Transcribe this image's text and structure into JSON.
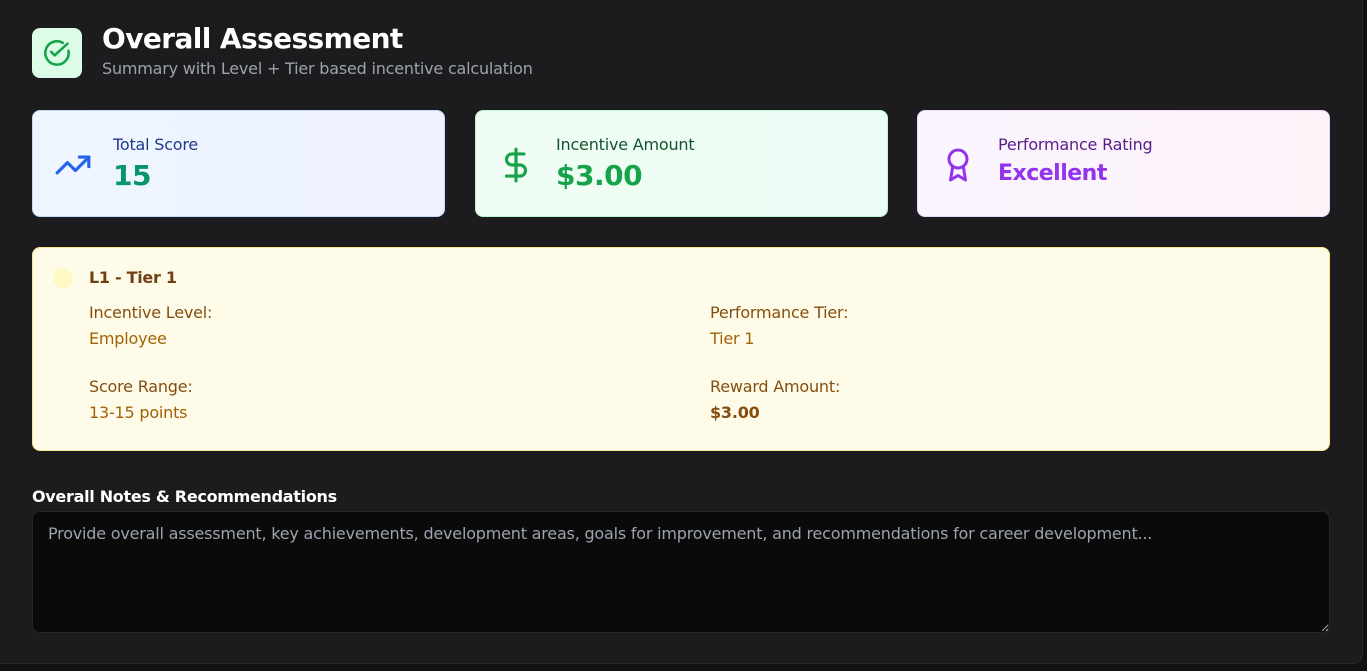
{
  "header": {
    "title": "Overall Assessment",
    "subtitle": "Summary with Level + Tier based incentive calculation",
    "icon": "check-circle-icon",
    "icon_color": "#16a34a"
  },
  "stats": {
    "score": {
      "label": "Total Score",
      "value": "15",
      "icon": "trending-up-icon"
    },
    "incentive": {
      "label": "Incentive Amount",
      "value": "$3.00",
      "icon": "dollar-sign-icon"
    },
    "rating": {
      "label": "Performance Rating",
      "value": "Excellent",
      "icon": "award-icon"
    }
  },
  "tier": {
    "title": "L1 - Tier 1",
    "incentive_level_label": "Incentive Level:",
    "incentive_level_value": "Employee",
    "performance_tier_label": "Performance Tier:",
    "performance_tier_value": "Tier 1",
    "score_range_label": "Score Range:",
    "score_range_value": "13-15 points",
    "reward_amount_label": "Reward Amount:",
    "reward_amount_value": "$3.00"
  },
  "notes": {
    "label": "Overall Notes & Recommendations",
    "value": "",
    "placeholder": "Provide overall assessment, key achievements, development areas, goals for improvement, and recommendations for career development..."
  },
  "colors": {
    "background": "#1c1c1f",
    "score_accent": "#2563eb",
    "incentive_accent": "#16a34a",
    "rating_accent": "#9333ea",
    "tier_background": "#fefce8"
  }
}
